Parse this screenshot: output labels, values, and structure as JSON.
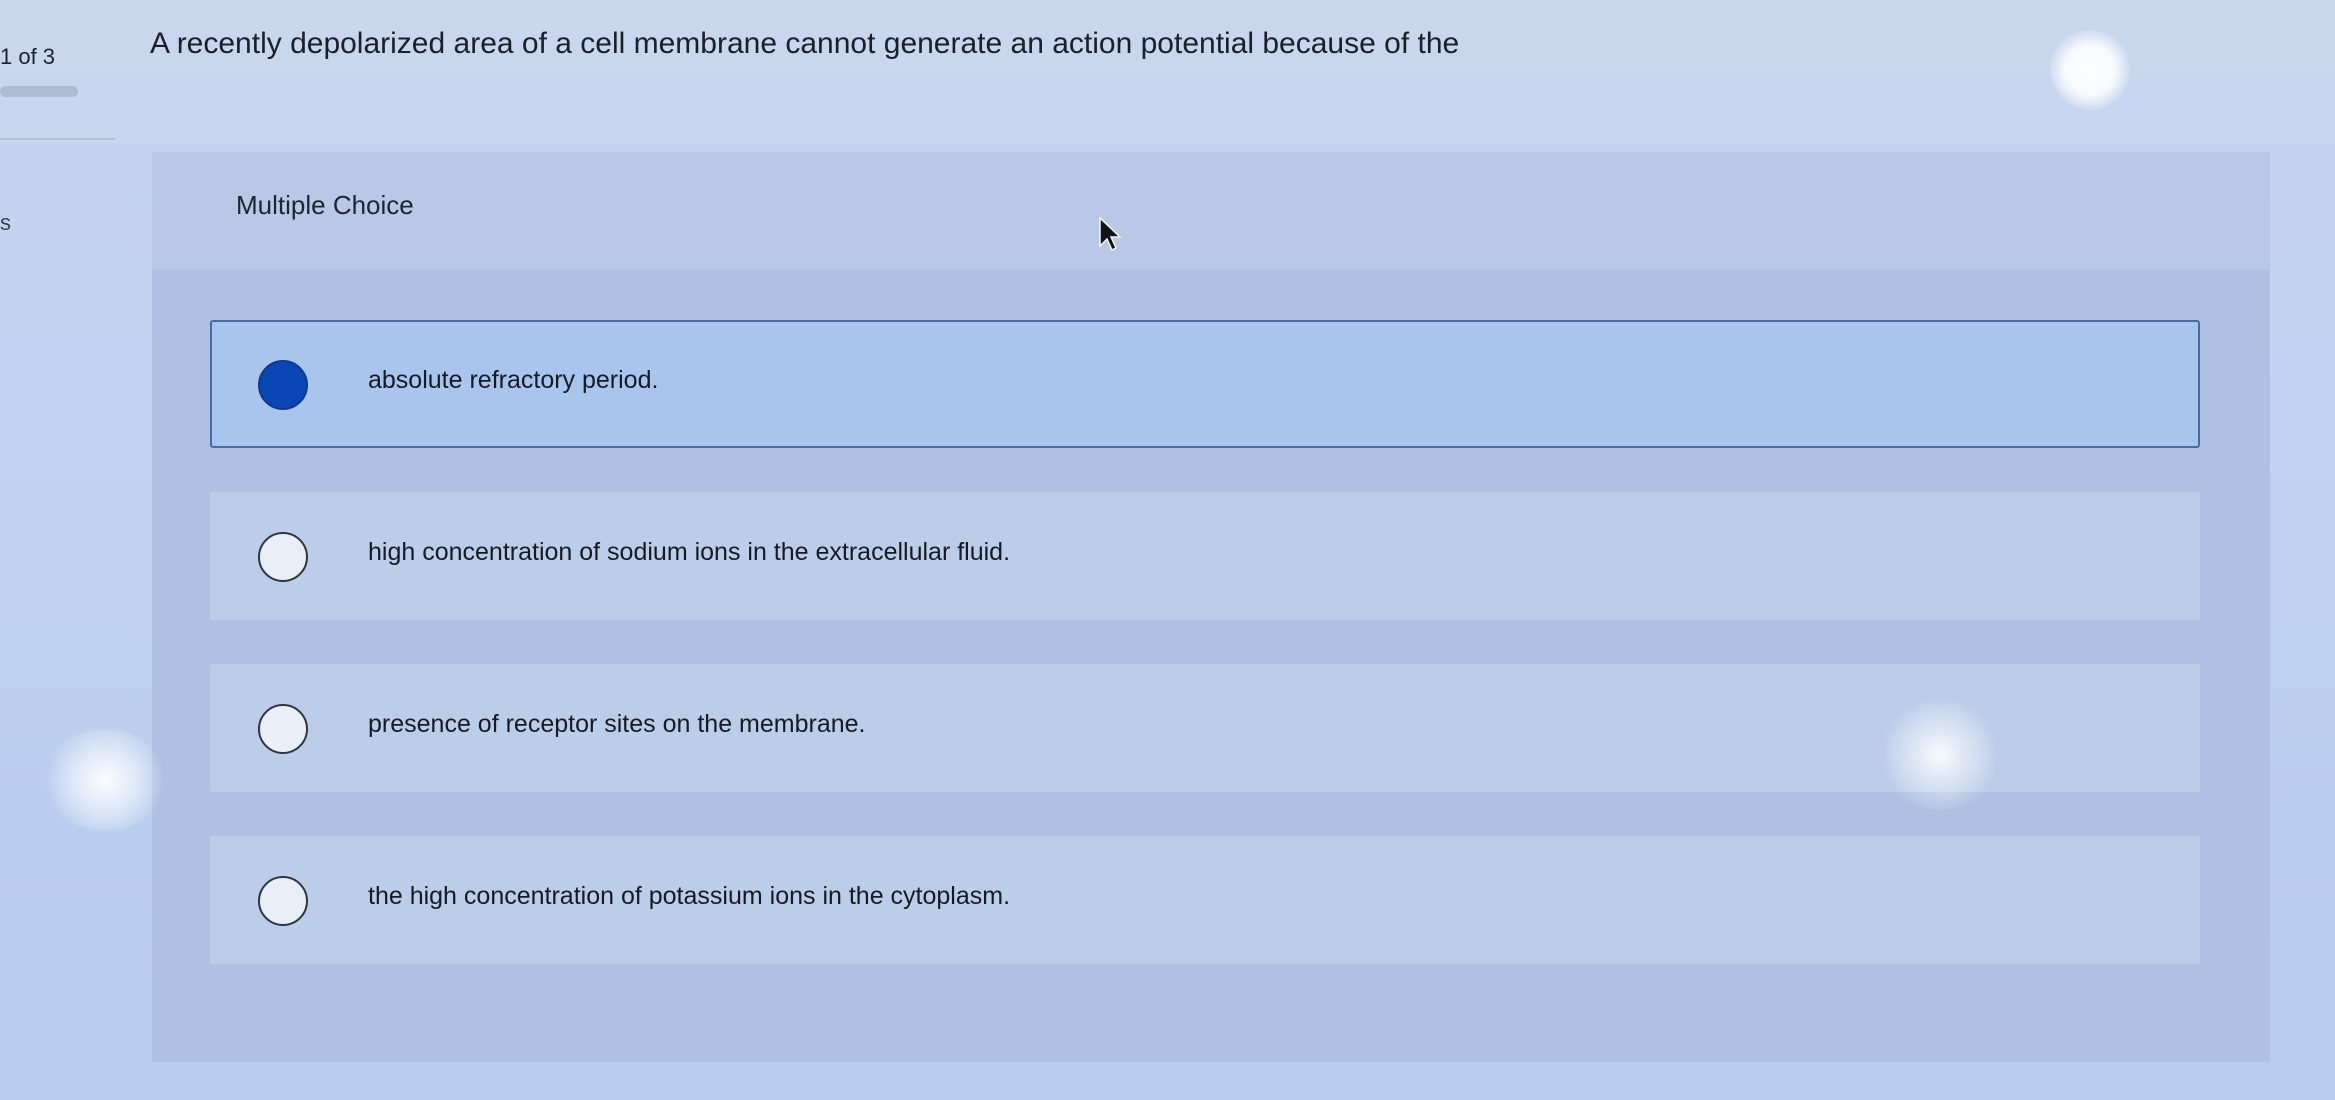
{
  "left_rail": {
    "counter": "1 of 3",
    "partial_label": "s"
  },
  "question": {
    "prompt": "A recently depolarized area of a cell membrane cannot generate an action potential because of the"
  },
  "answer_panel": {
    "type_label": "Multiple Choice",
    "options": [
      {
        "label": "absolute refractory period.",
        "selected": true
      },
      {
        "label": "high concentration of sodium ions in the extracellular fluid.",
        "selected": false
      },
      {
        "label": "presence of receptor sites on the membrane.",
        "selected": false
      },
      {
        "label": "the high concentration of potassium ions in the cytoplasm.",
        "selected": false
      }
    ]
  },
  "icons": {
    "cursor": "mouse-pointer-icon",
    "radio_selected": "radio-filled-icon",
    "radio_unselected": "radio-empty-icon"
  },
  "colors": {
    "accent": "#0a47b4",
    "selected_border": "#4a6aa0",
    "panel": "#afc1e3"
  }
}
